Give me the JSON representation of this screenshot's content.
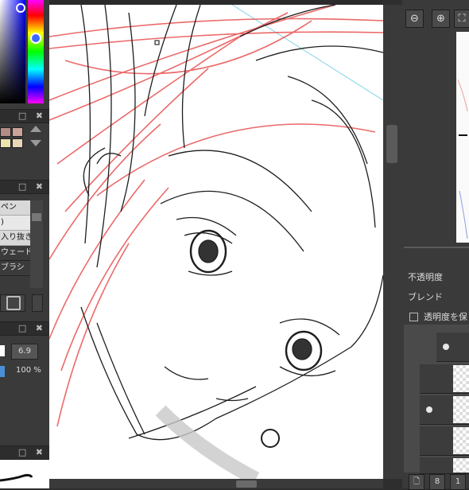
{
  "title_bar": {
    "text": "..."
  },
  "color_panel": {
    "panel_buttons": "□ ✖",
    "name": "color picker"
  },
  "palette_panel": {
    "panel_buttons": "□ ✖"
  },
  "brush_panel": {
    "panel_buttons": "□ ✖",
    "items": [
      "ペン",
      ")",
      "入り抜き",
      "ウェード",
      "ブラシ"
    ]
  },
  "brush_settings": {
    "panel_buttons": "□ ✖",
    "size_value": "6.9",
    "opacity_value": "100 %"
  },
  "preview_panel": {
    "panel_buttons": "□ ✖"
  },
  "navigator": {
    "zoom_in_icon": "zoom-in-icon",
    "zoom_out_icon": "zoom-out-icon",
    "fit_icon": "fit-icon"
  },
  "layer_properties": {
    "opacity_label": "不透明度",
    "blend_label": "ブレンド",
    "preserve_opacity_label": "透明度を保"
  },
  "colors": {
    "accent_hue": "#ff0000",
    "canvas_bg": "#ffffff",
    "sketch_line": "#222222",
    "red_guides": "#e85050"
  }
}
